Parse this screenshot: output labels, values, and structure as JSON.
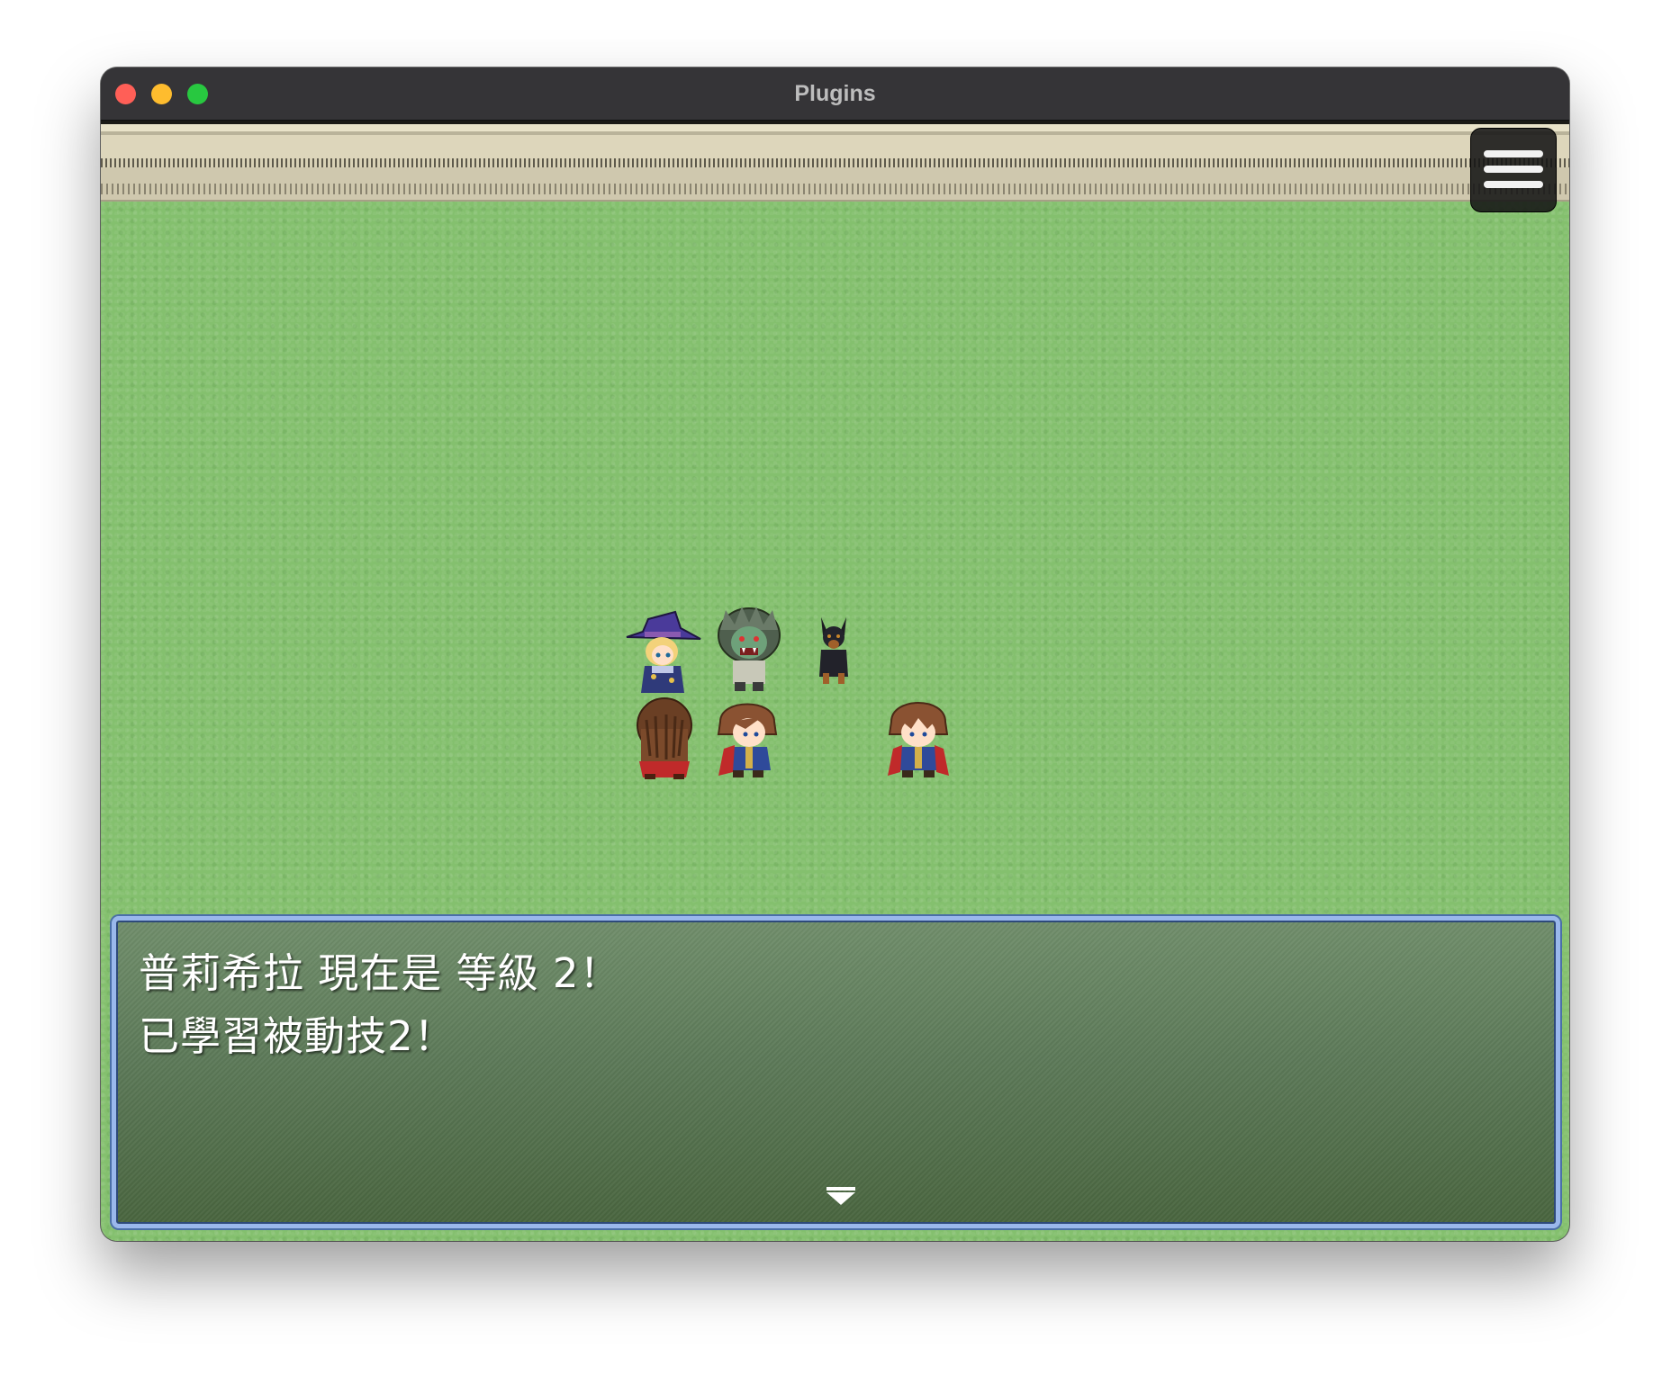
{
  "window": {
    "title": "Plugins"
  },
  "game": {
    "menu_button_icon": "hamburger-menu-icon",
    "party_sprites": [
      {
        "name": "witch-sprite",
        "row": "top"
      },
      {
        "name": "green-beast-sprite",
        "row": "top"
      },
      {
        "name": "black-dog-sprite",
        "row": "top"
      },
      {
        "name": "brown-hair-back-sprite",
        "row": "bottom"
      },
      {
        "name": "brown-hair-hero-sprite",
        "row": "bottom"
      },
      {
        "name": "brown-hair-hero-2-sprite",
        "row": "bottom"
      }
    ]
  },
  "message": {
    "line1": "普莉希拉 現在是 等級 2！",
    "line2": "已學習被動技2！",
    "continue_icon": "continue-arrow-icon"
  },
  "colors": {
    "grass": "#84c06e",
    "message_border": "#9ab8ec",
    "message_background": "#5d7a59",
    "titlebar": "#353437"
  }
}
